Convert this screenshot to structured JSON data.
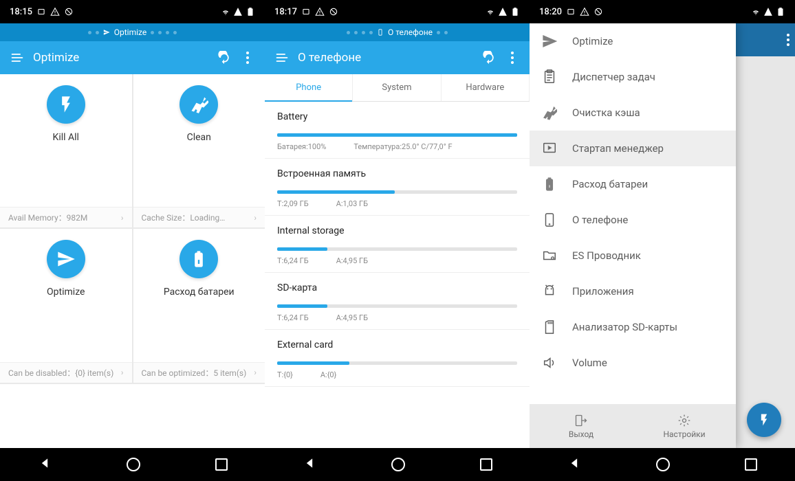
{
  "colors": {
    "brand": "#29a8e8",
    "brand_dark": "#0d8ac9"
  },
  "screen1": {
    "time": "18:15",
    "strip_label": "Optimize",
    "appbar_title": "Optimize",
    "tiles": [
      {
        "label": "Kill All",
        "footer": "Avail Memory：982M"
      },
      {
        "label": "Clean",
        "footer": "Cache Size：Loading…"
      },
      {
        "label": "Optimize",
        "footer": "Can be disabled：{0} item(s)"
      },
      {
        "label": "Расход батареи",
        "footer": "Can be optimized：5 item(s)"
      }
    ]
  },
  "screen2": {
    "time": "18:17",
    "strip_label": "О телефоне",
    "appbar_title": "О телефоне",
    "tabs": {
      "phone": "Phone",
      "system": "System",
      "hardware": "Hardware"
    },
    "sections": [
      {
        "title": "Battery",
        "fill": 100,
        "left": "Батарея:100%",
        "right": "Температура:25.0° C/77,0° F"
      },
      {
        "title": "Встроенная память",
        "fill": 49,
        "left": "T:2,09 ГБ",
        "right": "A:1,03 ГБ"
      },
      {
        "title": "Internal storage",
        "fill": 21,
        "left": "T:6,24 ГБ",
        "right": "A:4,95 ГБ"
      },
      {
        "title": "SD-карта",
        "fill": 21,
        "left": "T:6,24 ГБ",
        "right": "A:4,95 ГБ"
      },
      {
        "title": "External card",
        "fill": 30,
        "left": "T:{0}",
        "right": "A:{0}"
      }
    ]
  },
  "screen3": {
    "time": "18:20",
    "drawer_items": [
      {
        "icon": "send",
        "label": "Optimize"
      },
      {
        "icon": "clipboard",
        "label": "Диспетчер задач"
      },
      {
        "icon": "broom",
        "label": "Очистка кэша"
      },
      {
        "icon": "startup",
        "label": "Стартап менеджер",
        "selected": true
      },
      {
        "icon": "battery",
        "label": "Расход батареи"
      },
      {
        "icon": "phone",
        "label": "О телефоне"
      },
      {
        "icon": "folder",
        "label": "ES Проводник"
      },
      {
        "icon": "android",
        "label": "Приложения"
      },
      {
        "icon": "sd",
        "label": "Анализатор SD-карты"
      },
      {
        "icon": "volume",
        "label": "Volume"
      }
    ],
    "drawer_bottom": {
      "exit": "Выход",
      "settings": "Настройки"
    }
  }
}
